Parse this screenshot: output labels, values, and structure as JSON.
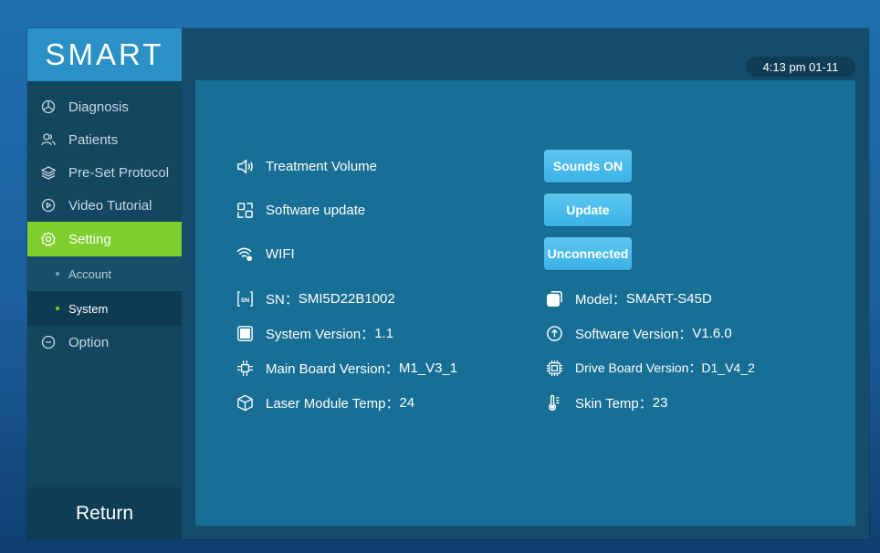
{
  "app": {
    "logo": "SMART"
  },
  "time": "4:13 pm 01-11",
  "sidebar": {
    "items": [
      {
        "label": "Diagnosis",
        "icon": "diagnosis-icon"
      },
      {
        "label": "Patients",
        "icon": "patients-icon"
      },
      {
        "label": "Pre-Set Protocol",
        "icon": "layers-icon"
      },
      {
        "label": "Video Tutorial",
        "icon": "play-icon"
      },
      {
        "label": "Setting",
        "icon": "gear-icon",
        "active": true
      },
      {
        "label": "Option",
        "icon": "option-icon"
      }
    ],
    "sub_items": [
      {
        "label": "Account"
      },
      {
        "label": "System",
        "selected": true
      }
    ],
    "return_label": "Return"
  },
  "settings": {
    "treatment_volume": {
      "label": "Treatment Volume",
      "button": "Sounds ON"
    },
    "software_update": {
      "label": "Software update",
      "button": "Update"
    },
    "wifi": {
      "label": "WIFI",
      "button": "Unconnected"
    }
  },
  "info": {
    "sn": {
      "label": "SN：",
      "value": "SMI5D22B1002"
    },
    "system_version": {
      "label": "System Version：",
      "value": "1.1"
    },
    "main_board_version": {
      "label": "Main Board Version：",
      "value": "M1_V3_1"
    },
    "laser_module_temp": {
      "label": "Laser Module Temp：",
      "value": "24"
    },
    "model": {
      "label": "Model：",
      "value": "SMART-S45D"
    },
    "software_version": {
      "label": "Software Version：",
      "value": "V1.6.0"
    },
    "drive_board_version": {
      "label": "Drive Board Version：",
      "value": "D1_V4_2"
    },
    "skin_temp": {
      "label": "Skin Temp：",
      "value": "23"
    }
  },
  "colors": {
    "accent_green": "#7fcf2c",
    "button_blue": "#3bb1e6",
    "panel_blue": "#176f95",
    "logo_blue": "#2a90c6"
  }
}
